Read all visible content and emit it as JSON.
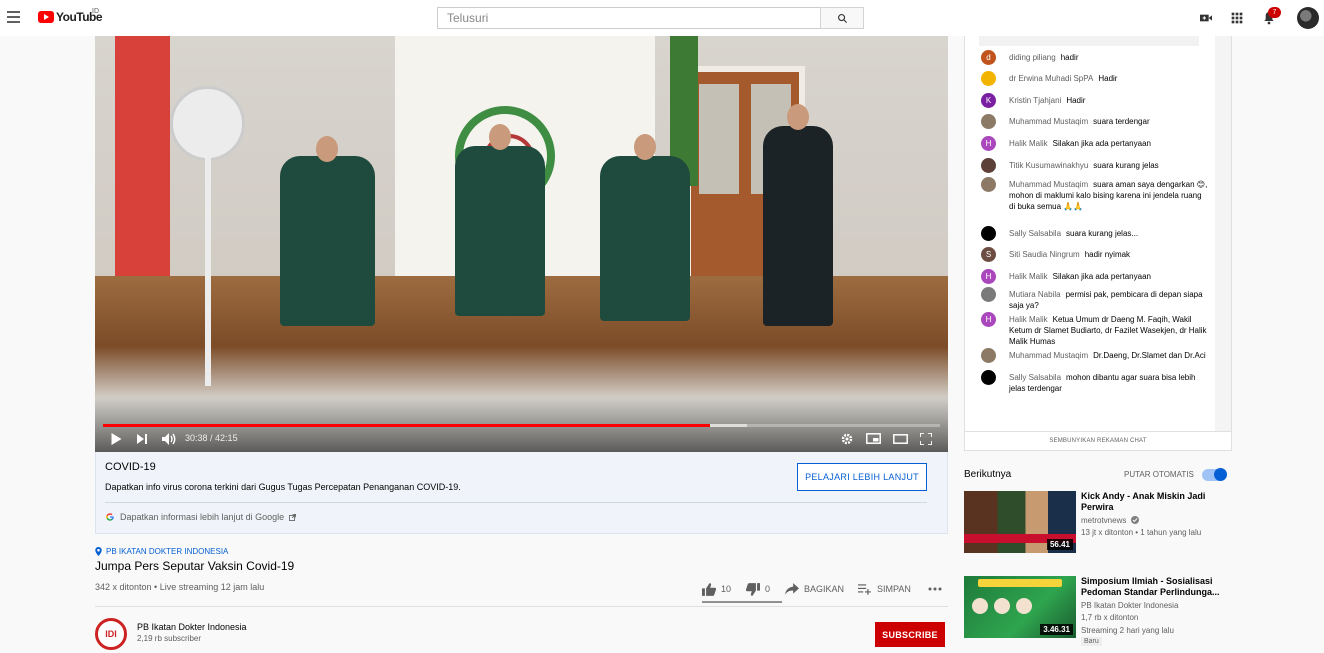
{
  "header": {
    "logo_text": "YouTube",
    "country_code": "ID",
    "search_placeholder": "Telusuri",
    "notification_count": "7"
  },
  "player": {
    "time_current": "30:38",
    "time_separator": " / ",
    "time_total": "42:15",
    "progress_fraction": 0.725,
    "buffer_fraction": 0.77
  },
  "info_panel": {
    "title": "COVID-19",
    "description": "Dapatkan info virus corona terkini dari Gugus Tugas Percepatan Penanganan COVID-19.",
    "learn_more": "PELAJARI LEBIH LANJUT",
    "google_link": "Dapatkan informasi lebih lanjut di Google"
  },
  "video": {
    "location": "PB IKATAN DOKTER INDONESIA",
    "title": "Jumpa Pers Seputar Vaksin Covid-19",
    "meta": "342 x ditonton • Live streaming 12 jam lalu",
    "likes": "10",
    "dislikes": "0",
    "share": "BAGIKAN",
    "save": "SIMPAN"
  },
  "channel": {
    "name": "PB Ikatan Dokter Indonesia",
    "subscribers": "2,19 rb subscriber",
    "avatar_text": "IDI",
    "subscribe": "SUBSCRIBE"
  },
  "chat": {
    "hide_label": "SEMBUNYIKAN REKAMAN CHAT",
    "messages": [
      {
        "author": "diding piliang",
        "text": "hadir",
        "initial": "d",
        "color": "#c1541c"
      },
      {
        "author": "dr Erwina Muhadi SpPA",
        "text": "Hadir",
        "initial": "",
        "color": "#f2b400"
      },
      {
        "author": "Kristin Tjahjani",
        "text": "Hadir",
        "initial": "K",
        "color": "#7b1fa2"
      },
      {
        "author": "Muhammad Mustaqim",
        "text": "suara terdengar",
        "initial": "",
        "color": "#8c7a66"
      },
      {
        "author": "Halik Malik",
        "text": "Silakan jika ada pertanyaan",
        "initial": "H",
        "color": "#ab47bc"
      },
      {
        "author": "Titik Kusumawinakhyu",
        "text": "suara kurang jelas",
        "initial": "",
        "color": "#5d4037"
      },
      {
        "author": "Muhammad Mustaqim",
        "text": "suara aman saya dengarkan 😊, mohon di maklumi kalo bising karena ini jendela ruang di buka semua 🙏🙏",
        "initial": "",
        "color": "#8c7a66"
      },
      {
        "author": "Sally Salsabila",
        "text": "suara kurang jelas...",
        "initial": "",
        "color": "#000000"
      },
      {
        "author": "Siti Saudia Ningrum",
        "text": "hadir nyimak",
        "initial": "S",
        "color": "#6d4c41"
      },
      {
        "author": "Halik Malik",
        "text": "Silakan jika ada pertanyaan",
        "initial": "H",
        "color": "#ab47bc"
      },
      {
        "author": "Mutiara Nabila",
        "text": "permisi pak, pembicara di depan siapa saja ya?",
        "initial": "",
        "color": "#7a7a7a"
      },
      {
        "author": "Halik Malik",
        "text": "Ketua Umum dr Daeng M. Faqih, Wakil Ketum dr Slamet Budiarto, dr Fazilet Wasekjen, dr Halik Malik Humas",
        "initial": "H",
        "color": "#ab47bc"
      },
      {
        "author": "Muhammad Mustaqim",
        "text": "Dr.Daeng, Dr.Slamet dan Dr.Aci",
        "initial": "",
        "color": "#8c7a66"
      },
      {
        "author": "Sally Salsabila",
        "text": "mohon dibantu agar suara bisa lebih jelas terdengar",
        "initial": "",
        "color": "#000000"
      }
    ]
  },
  "upnext": {
    "label": "Berikutnya",
    "autoplay": "PUTAR OTOMATIS",
    "items": [
      {
        "title": "Kick Andy - Anak Miskin Jadi Perwira",
        "channel": "metrotvnews",
        "meta": "13 jt x ditonton • 1 tahun yang lalu",
        "duration": "56.41",
        "verified": true
      },
      {
        "title": "Simposium Ilmiah - Sosialisasi Pedoman Standar Perlindunga...",
        "channel": "PB Ikatan Dokter Indonesia",
        "meta": "1,7 rb x ditonton",
        "meta2": "Streaming 2 hari yang lalu",
        "badge": "Baru",
        "duration": "3.46.31"
      }
    ]
  }
}
